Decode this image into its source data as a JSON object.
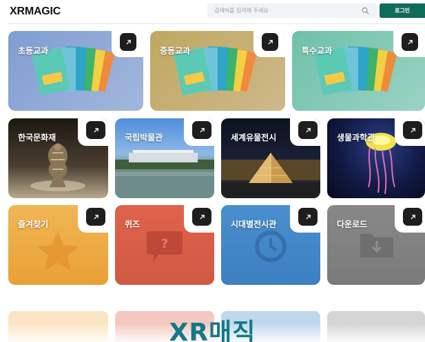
{
  "header": {
    "logo": "XRMAGIC",
    "search_placeholder": "검색어를 입력해 주세요",
    "login_label": "로그인"
  },
  "colors": {
    "brand": "#0f6b5c",
    "heading": "#11798a"
  },
  "textbooks": [
    {
      "label": "초등교과",
      "icon": "textbook-stack-icon"
    },
    {
      "label": "중등교과",
      "icon": "textbook-stack-icon"
    },
    {
      "label": "특수교과",
      "icon": "textbook-stack-icon"
    }
  ],
  "museums": [
    {
      "label": "한국문화재",
      "icon": "artifact-photo"
    },
    {
      "label": "국립박물관",
      "icon": "museum-photo"
    },
    {
      "label": "세계유물전시",
      "icon": "louvre-pyramid-photo"
    },
    {
      "label": "생물과학관",
      "icon": "jellyfish-photo"
    }
  ],
  "tools": [
    {
      "label": "즐겨찾기",
      "icon": "star-icon"
    },
    {
      "label": "퀴즈",
      "icon": "question-bubble-icon"
    },
    {
      "label": "시대별전시관",
      "icon": "history-clock-icon"
    },
    {
      "label": "다운로드",
      "icon": "download-folder-icon"
    }
  ],
  "section_title": "XR매직"
}
